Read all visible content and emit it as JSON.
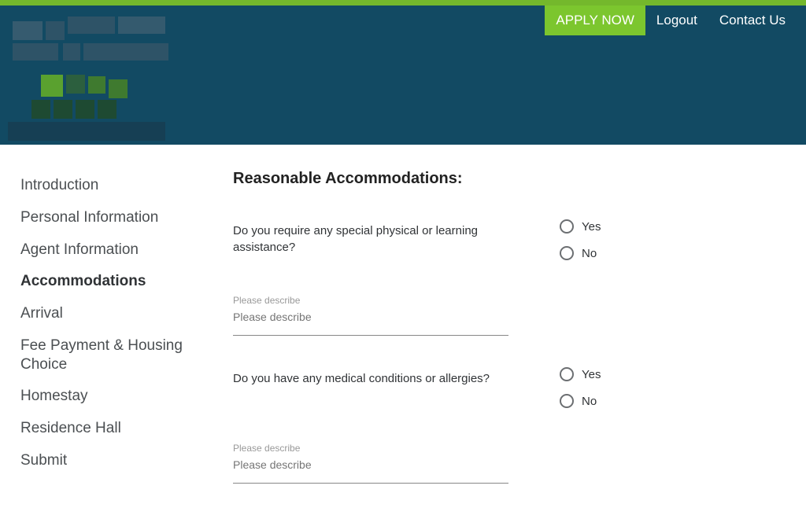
{
  "header": {
    "apply_label": "APPLY NOW",
    "logout_label": "Logout",
    "contact_label": "Contact Us"
  },
  "sidebar": {
    "items": [
      {
        "label": "Introduction",
        "active": false
      },
      {
        "label": "Personal Information",
        "active": false
      },
      {
        "label": "Agent Information",
        "active": false
      },
      {
        "label": "Accommodations",
        "active": true
      },
      {
        "label": "Arrival",
        "active": false
      },
      {
        "label": "Fee Payment & Housing Choice",
        "active": false
      },
      {
        "label": "Homestay",
        "active": false
      },
      {
        "label": "Residence Hall",
        "active": false
      },
      {
        "label": "Submit",
        "active": false
      }
    ]
  },
  "main": {
    "title": "Reasonable Accommodations:",
    "questions": [
      {
        "text": "Do you require any special physical or learning assistance?",
        "yes_label": "Yes",
        "no_label": "No",
        "desc_placeholder": "Please describe",
        "desc_value": ""
      },
      {
        "text": "Do you have any medical conditions or allergies?",
        "yes_label": "Yes",
        "no_label": "No",
        "desc_placeholder": "Please describe",
        "desc_value": ""
      }
    ]
  },
  "colors": {
    "accent_green": "#7cc62e",
    "banner_blue": "#124a63"
  }
}
